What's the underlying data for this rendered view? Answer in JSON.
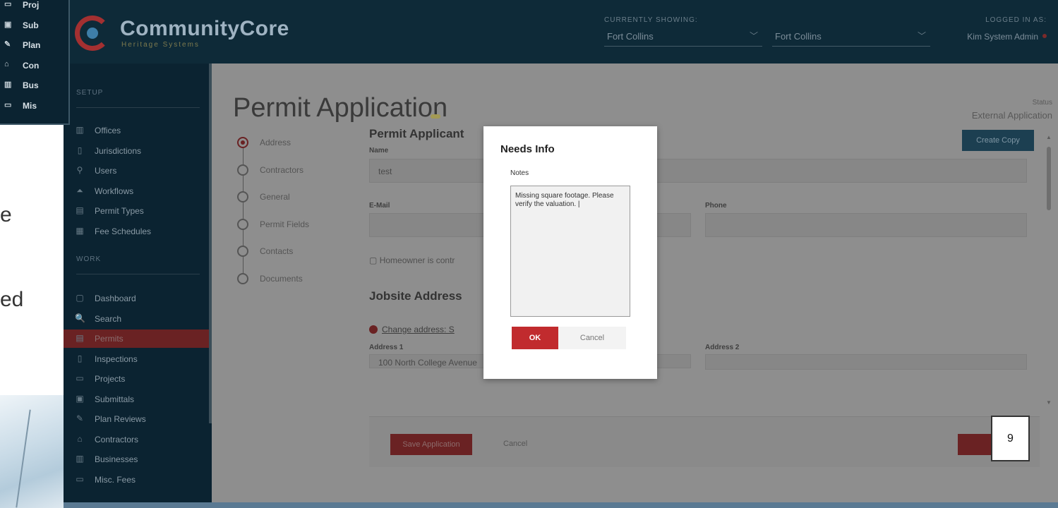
{
  "app": {
    "brand": "CommunityCore",
    "brand_sub": "Heritage Systems",
    "currently_showing_label": "CURRENTLY SHOWING:",
    "select_1": "Fort Collins",
    "select_2": "Fort Collins",
    "logged_in_label": "LOGGED IN AS:",
    "user": "Kim System Admin"
  },
  "sidebar": {
    "setup_heading": "SETUP",
    "setup_items": [
      {
        "label": "Offices",
        "icon": "offices-icon",
        "glyph": "▥"
      },
      {
        "label": "Jurisdictions",
        "icon": "jurisdictions-icon",
        "glyph": "▯"
      },
      {
        "label": "Users",
        "icon": "users-icon",
        "glyph": "⚲"
      },
      {
        "label": "Workflows",
        "icon": "workflows-icon",
        "glyph": "⏶"
      },
      {
        "label": "Permit Types",
        "icon": "permit-types-icon",
        "glyph": "▤"
      },
      {
        "label": "Fee Schedules",
        "icon": "fee-schedules-icon",
        "glyph": "▦"
      }
    ],
    "work_heading": "WORK",
    "work_items": [
      {
        "label": "Dashboard",
        "icon": "dashboard-icon",
        "glyph": "▢"
      },
      {
        "label": "Search",
        "icon": "search-icon",
        "glyph": "🔍"
      },
      {
        "label": "Permits",
        "icon": "permits-icon",
        "glyph": "▤"
      },
      {
        "label": "Inspections",
        "icon": "inspections-icon",
        "glyph": "▯"
      },
      {
        "label": "Projects",
        "icon": "projects-icon",
        "glyph": "▭"
      },
      {
        "label": "Submittals",
        "icon": "submittals-icon",
        "glyph": "▣"
      },
      {
        "label": "Plan Reviews",
        "icon": "plan-reviews-icon",
        "glyph": "✎"
      },
      {
        "label": "Contractors",
        "icon": "contractors-icon",
        "glyph": "⌂"
      },
      {
        "label": "Businesses",
        "icon": "businesses-icon",
        "glyph": "▥"
      },
      {
        "label": "Misc. Fees",
        "icon": "misc-fees-icon",
        "glyph": "▭"
      }
    ]
  },
  "main": {
    "title": "Permit Application",
    "status_label": "Status",
    "status_value": "External Application",
    "create_copy": "Create Copy",
    "steps": [
      "Address",
      "Contractors",
      "General",
      "Permit Fields",
      "Contacts",
      "Documents"
    ],
    "applicant_title": "Permit Applicant",
    "name_label": "Name",
    "name_value": "test",
    "email_label": "E-Mail",
    "phone_label": "Phone",
    "homeowner_text": "Homeowner is contr",
    "jobsite_title": "Jobsite Address",
    "change_address": "Change address: S",
    "address1_label": "Address 1",
    "address1_value": "100 North College Avenue",
    "address2_label": "Address 2",
    "save_button": "Save Application",
    "cancel_link": "Cancel"
  },
  "modal": {
    "title": "Needs Info",
    "notes_label": "Notes",
    "notes_value": "Missing square footage. Please verify the valuation. |",
    "ok": "OK",
    "cancel": "Cancel"
  },
  "callout": "9",
  "inset": {
    "items": [
      {
        "label": "Proj",
        "icon": "projects-icon",
        "glyph": "▭"
      },
      {
        "label": "Sub",
        "icon": "submittals-icon",
        "glyph": "▣"
      },
      {
        "label": "Plan",
        "icon": "plan-reviews-icon",
        "glyph": "✎"
      },
      {
        "label": "Con",
        "icon": "contractors-icon",
        "glyph": "⌂"
      },
      {
        "label": "Bus",
        "icon": "businesses-icon",
        "glyph": "▥"
      },
      {
        "label": "Mis",
        "icon": "misc-fees-icon",
        "glyph": "▭"
      }
    ]
  },
  "slide_fragments": [
    "e",
    "ed"
  ],
  "colors": {
    "topbar": "#0e2a38",
    "sidebar": "#0b2331",
    "accent_red": "#c12b2e",
    "dim_red": "#6a2223",
    "overlay_gray": "#8e8e8e"
  }
}
